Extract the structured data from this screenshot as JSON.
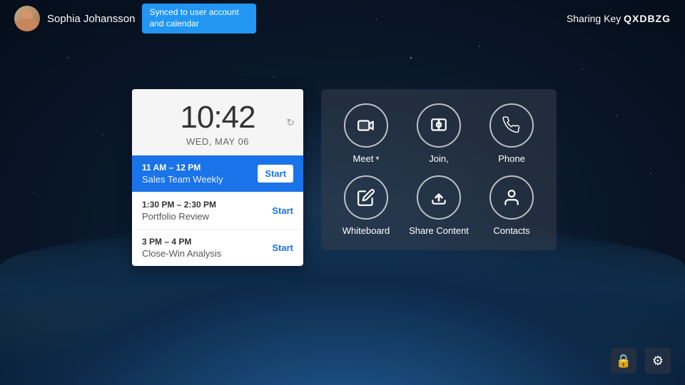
{
  "user": {
    "name": "Sophia Johansson",
    "sync_status": "Synced to user account and calendar"
  },
  "sharing": {
    "label": "Sharing Key",
    "key": "QXDBZG"
  },
  "clock": {
    "time": "10:42",
    "date": "WED, MAY 06"
  },
  "meetings": [
    {
      "time": "11 AM – 12 PM",
      "title": "Sales Team Weekly",
      "button": "Start",
      "active": true
    },
    {
      "time": "1:30 PM – 2:30 PM",
      "title": "Portfolio Review",
      "button": "Start",
      "active": false
    },
    {
      "time": "3 PM – 4 PM",
      "title": "Close-Win Analysis",
      "button": "Start",
      "active": false
    }
  ],
  "actions": [
    {
      "id": "meet",
      "label": "Meet",
      "has_chevron": true
    },
    {
      "id": "join",
      "label": "Join,",
      "has_chevron": false
    },
    {
      "id": "phone",
      "label": "Phone",
      "has_chevron": false
    },
    {
      "id": "whiteboard",
      "label": "Whiteboard",
      "has_chevron": false
    },
    {
      "id": "share-content",
      "label": "Share Content",
      "has_chevron": false
    },
    {
      "id": "contacts",
      "label": "Contacts",
      "has_chevron": false
    }
  ],
  "bottom_icons": [
    {
      "id": "lock",
      "icon": "🔒"
    },
    {
      "id": "settings",
      "icon": "⚙"
    }
  ]
}
